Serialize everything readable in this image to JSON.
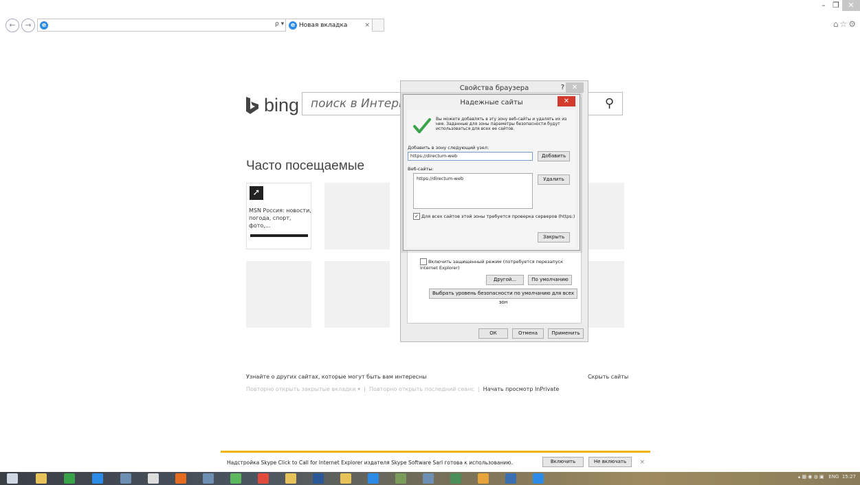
{
  "browser": {
    "address_value": "",
    "tab_title": "Новая вкладка",
    "tab_close": "×",
    "search_glyph": "ρ ▾ C",
    "toolbar_icons": "⌂☆⚙",
    "window_controls": {
      "minimize": "–",
      "restore": "❐",
      "close": "✕"
    }
  },
  "newtab": {
    "bing_text": "bing",
    "search_placeholder": "поиск в Интернет",
    "frequent_heading": "Часто посещаемые",
    "msn_tile_text": "MSN Россия: новости, погода, спорт, фото,...",
    "footer_discover": "Узнайте о других сайтах, которые могут быть вам интересны",
    "footer_reopen_tabs": "Повторно открыть закрытые вкладки ▾",
    "footer_separator": "|",
    "footer_reopen_session": "Повторно открыть последний сеанс",
    "footer_inprivate": "Начать просмотр InPrivate",
    "hide_sites": "Скрыть сайты"
  },
  "browser_properties": {
    "title": "Свойства браузера",
    "help": "?",
    "close": "✕",
    "protected_mode_label": "Включить защищенный режим (потребуется перезапуск Internet Explorer)",
    "custom_button": "Другой...",
    "default_button": "По умолчанию",
    "reset_all_button": "Выбрать уровень безопасности по умолчанию для всех зон",
    "ok": "ОК",
    "cancel": "Отмена",
    "apply": "Применить"
  },
  "trusted_sites": {
    "title": "Надежные сайты",
    "close": "✕",
    "info": "Вы можете добавлять в эту зону веб-сайты и удалять их из нее. Заданные для зоны параметры безопасности будут использоваться для всех ее сайтов.",
    "add_label": "Добавить в зону следующий узел:",
    "add_value": "https://directum-web",
    "add_button": "Добавить",
    "websites_label": "Веб-сайты:",
    "websites": [
      "https://directum-web"
    ],
    "remove_button": "Удалить",
    "require_https_label": "Для всех сайтов этой зоны требуется проверка серверов (https:)",
    "require_https_checked": true,
    "close_button": "Закрыть"
  },
  "skype_bar": {
    "message": "Надстройка Skype Click to Call for Internet Explorer издателя Skype Software Sarl готова к использованию.",
    "enable": "Включить",
    "disable": "Не включать",
    "close": "×"
  },
  "taskbar": {
    "lang": "ENG",
    "time": "15:27"
  }
}
